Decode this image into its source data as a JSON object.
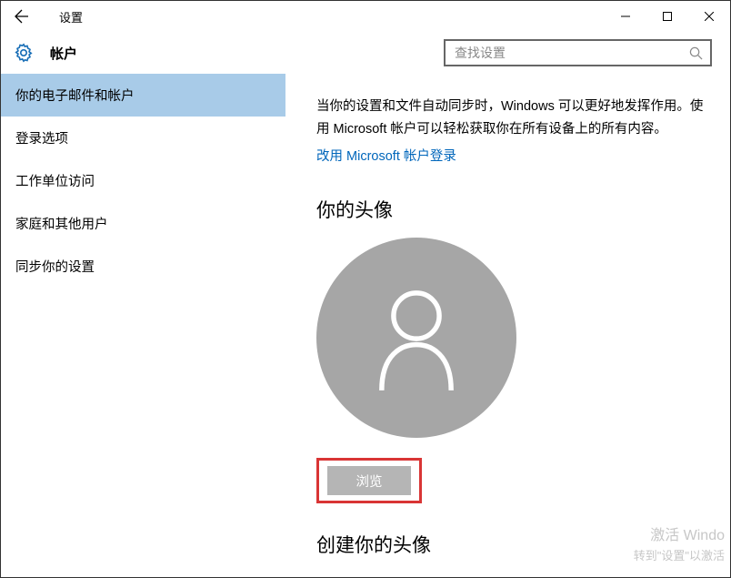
{
  "titlebar": {
    "title": "设置"
  },
  "header": {
    "page_title": "帐户",
    "search_placeholder": "查找设置"
  },
  "sidebar": {
    "items": [
      {
        "label": "你的电子邮件和帐户",
        "selected": true
      },
      {
        "label": "登录选项",
        "selected": false
      },
      {
        "label": "工作单位访问",
        "selected": false
      },
      {
        "label": "家庭和其他用户",
        "selected": false
      },
      {
        "label": "同步你的设置",
        "selected": false
      }
    ]
  },
  "main": {
    "description": "当你的设置和文件自动同步时，Windows 可以更好地发挥作用。使用 Microsoft 帐户可以轻松获取你在所有设备上的所有内容。",
    "link": "改用 Microsoft 帐户登录",
    "avatar_heading": "你的头像",
    "browse_label": "浏览",
    "create_heading": "创建你的头像"
  },
  "watermark": {
    "line1": "激活 Windo",
    "line2": "转到\"设置\"以激活"
  }
}
